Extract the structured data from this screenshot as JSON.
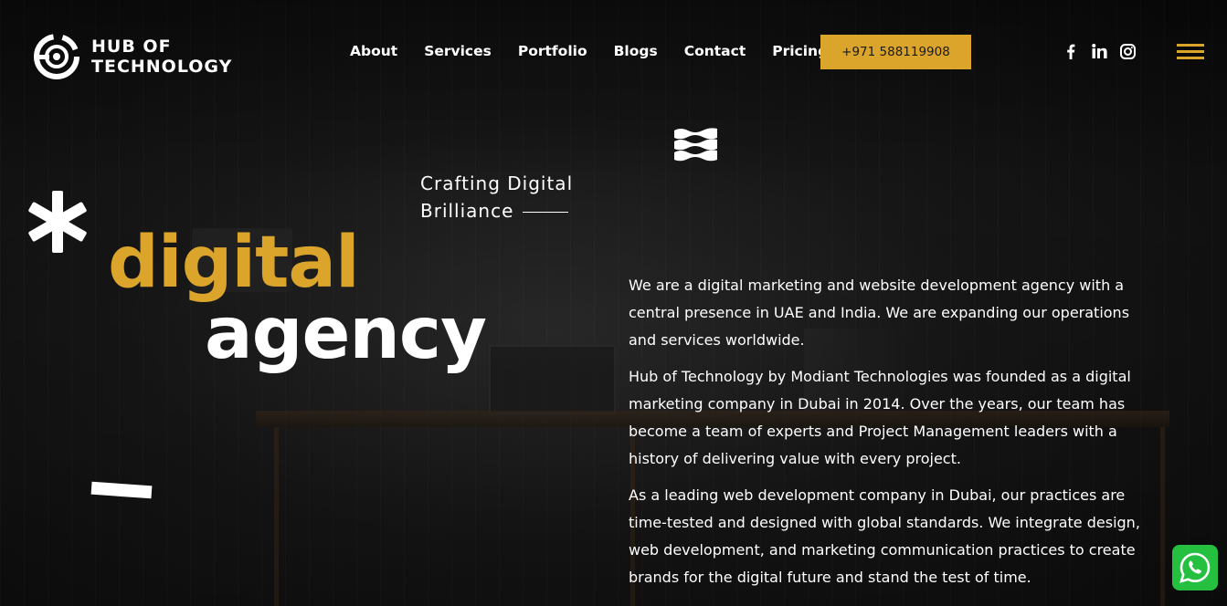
{
  "brand": {
    "logo_line1": "HUB OF",
    "logo_line2": "TECHNOLOGY"
  },
  "nav": {
    "items": [
      {
        "label": "About"
      },
      {
        "label": "Services"
      },
      {
        "label": "Portfolio"
      },
      {
        "label": "Blogs"
      },
      {
        "label": "Contact"
      },
      {
        "label": "Pricing"
      }
    ]
  },
  "header": {
    "phone_label": "+971 588119908",
    "social_icons": [
      "facebook-icon",
      "linkedin-icon",
      "instagram-icon"
    ],
    "menu_icon": "hamburger-menu-icon"
  },
  "hero": {
    "tagline_line1": "Crafting Digital",
    "tagline_line2": "Brilliance",
    "word1": "digital",
    "word2": "agency"
  },
  "about": {
    "paragraphs": [
      "We are a digital marketing and website development agency with a central presence in UAE and India. We are expanding our operations and services worldwide.",
      "Hub of Technology by Modiant Technologies was founded as a digital marketing company in Dubai in 2014. Over the years, our team has become a team of experts and Project Management leaders with a history of delivering value with every project.",
      "As a leading web development company in Dubai, our practices are time-tested and designed with global standards. We integrate design, web development, and marketing communication practices to create brands for the digital future and stand the test of time."
    ]
  },
  "colors": {
    "accent": "#dba42b",
    "background": "#101010",
    "text": "#ffffff",
    "whatsapp": "#25c03f"
  },
  "widgets": {
    "chat_icon": "whatsapp-icon"
  }
}
